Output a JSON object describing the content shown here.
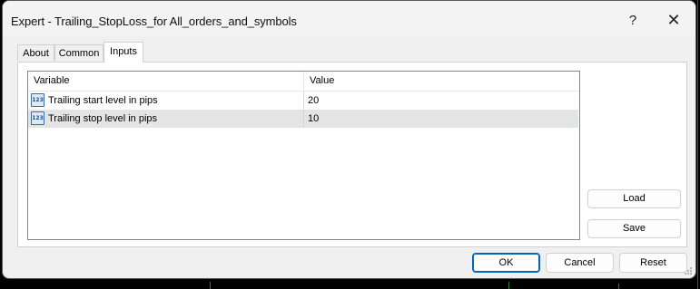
{
  "window": {
    "title": "Expert - Trailing_StopLoss_for All_orders_and_symbols",
    "help_glyph": "?",
    "close_glyph": "✕"
  },
  "tabs": [
    {
      "label": "About",
      "active": false
    },
    {
      "label": "Common",
      "active": false
    },
    {
      "label": "Inputs",
      "active": true
    }
  ],
  "inputs_table": {
    "columns": [
      "Variable",
      "Value"
    ],
    "rows": [
      {
        "icon": "integer-param-icon",
        "icon_text": "123",
        "variable": "Trailing start level in pips",
        "value": "20",
        "selected": false
      },
      {
        "icon": "integer-param-icon",
        "icon_text": "123",
        "variable": "Trailing stop level in pips",
        "value": "10",
        "selected": true
      }
    ]
  },
  "side_buttons": {
    "load": "Load",
    "save": "Save"
  },
  "footer_buttons": {
    "ok": "OK",
    "cancel": "Cancel",
    "reset": "Reset"
  },
  "colors": {
    "accent": "#0067c0",
    "selected_row": "#e4e4e4",
    "dialog_bg": "#f0f0f0"
  }
}
